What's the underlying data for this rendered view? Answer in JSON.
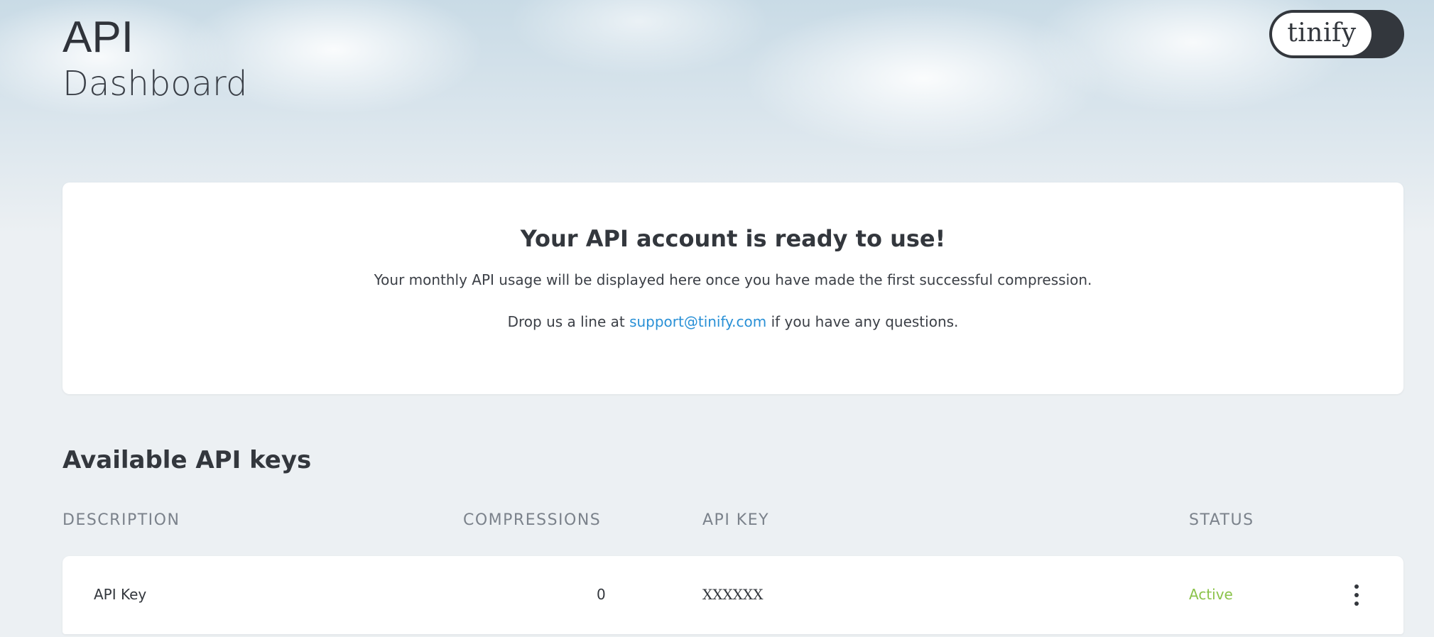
{
  "header": {
    "title": "API",
    "subtitle": "Dashboard",
    "logo_text": "tinify"
  },
  "notice": {
    "heading": "Your API account is ready to use!",
    "usage_text": "Your monthly API usage will be displayed here once you have made the first successful compression.",
    "contact_prefix": "Drop us a line at ",
    "contact_email": "support@tinify.com",
    "contact_suffix": " if you have any questions."
  },
  "keys": {
    "section_title": "Available API keys",
    "columns": {
      "description": "DESCRIPTION",
      "compressions": "COMPRESSIONS",
      "api_key": "API KEY",
      "status": "STATUS"
    },
    "rows": [
      {
        "description": "API Key",
        "compressions": "0",
        "api_key": "XXXXXX",
        "status": "Active"
      }
    ]
  },
  "colors": {
    "text_dark": "#33373d",
    "link": "#2990d6",
    "status_active": "#8bc34a",
    "muted": "#7b828b"
  }
}
